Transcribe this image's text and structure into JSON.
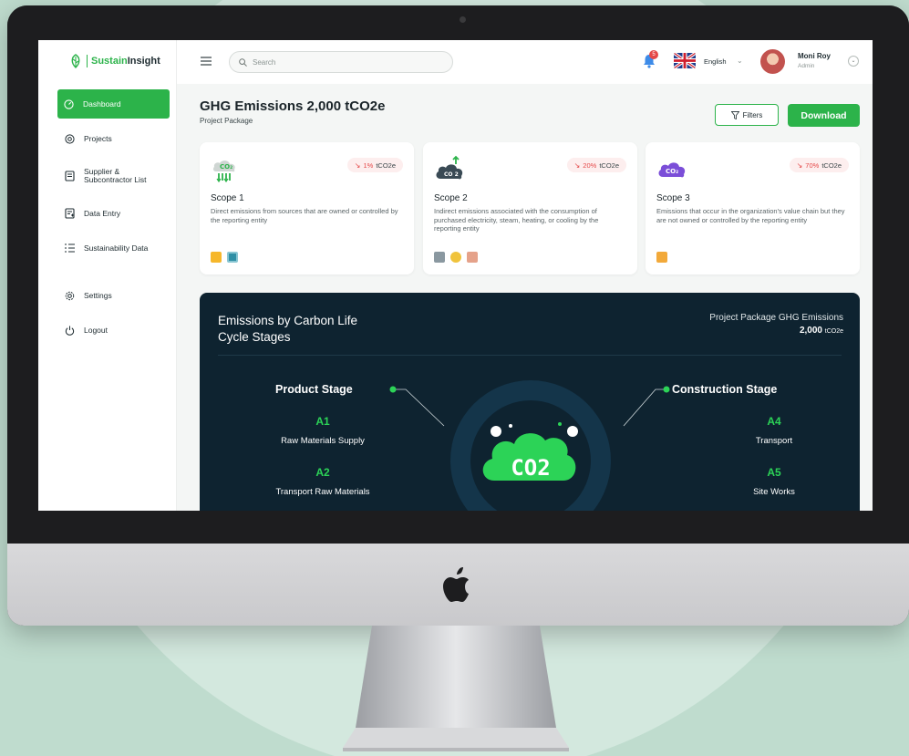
{
  "brand": {
    "part1": "Sustain",
    "part2": "Insight"
  },
  "sidebar": {
    "items": [
      {
        "label": "Dashboard",
        "icon": "dashboard-icon",
        "active": true
      },
      {
        "label": "Projects",
        "icon": "projects-icon"
      },
      {
        "label": "Supplier &",
        "label2": "Subcontractor List",
        "icon": "document-icon"
      },
      {
        "label": "Data Entry",
        "icon": "data-entry-icon"
      },
      {
        "label": "Sustainability Data",
        "icon": "list-icon"
      },
      {
        "label": "Settings",
        "icon": "gear-icon"
      },
      {
        "label": "Logout",
        "icon": "power-icon"
      }
    ]
  },
  "topbar": {
    "search_placeholder": "Search",
    "notification_count": "5",
    "language": "English",
    "user": {
      "name": "Moni Roy",
      "role": "Admin"
    }
  },
  "page": {
    "title": "GHG Emissions 2,000 tCO2e",
    "subtitle": "Project Package",
    "filters_label": "Filters",
    "download_label": "Download"
  },
  "scopes": [
    {
      "title": "Scope 1",
      "pct": "1%",
      "unit": "tCO2e",
      "desc": "Direct emissions from sources that are owned or controlled by the reporting entity"
    },
    {
      "title": "Scope 2",
      "pct": "20%",
      "unit": "tCO2e",
      "desc": "Indirect emissions associated with the consumption of purchased electricity, steam, heating, or cooling by the reporting entity"
    },
    {
      "title": "Scope 3",
      "pct": "70%",
      "unit": "tCO2e",
      "desc": "Emissions that occur in the organization's value chain but they are not owned or controlled by the reporting entity"
    }
  ],
  "lifecycle": {
    "title": "Emissions by Carbon Life Cycle Stages",
    "right_label": "Project Package GHG Emissions",
    "right_value": "2,000",
    "right_unit": "tCO2e",
    "center_text": "CO2",
    "product_stage": {
      "title": "Product Stage",
      "items": [
        {
          "code": "A1",
          "name": "Raw Materials Supply"
        },
        {
          "code": "A2",
          "name": "Transport Raw Materials"
        }
      ]
    },
    "construction_stage": {
      "title": "Construction Stage",
      "items": [
        {
          "code": "A4",
          "name": "Transport"
        },
        {
          "code": "A5",
          "name": "Site Works"
        }
      ]
    }
  },
  "colors": {
    "accent": "#2cb34a",
    "dark_panel": "#0e2330",
    "negative": "#e54848"
  }
}
